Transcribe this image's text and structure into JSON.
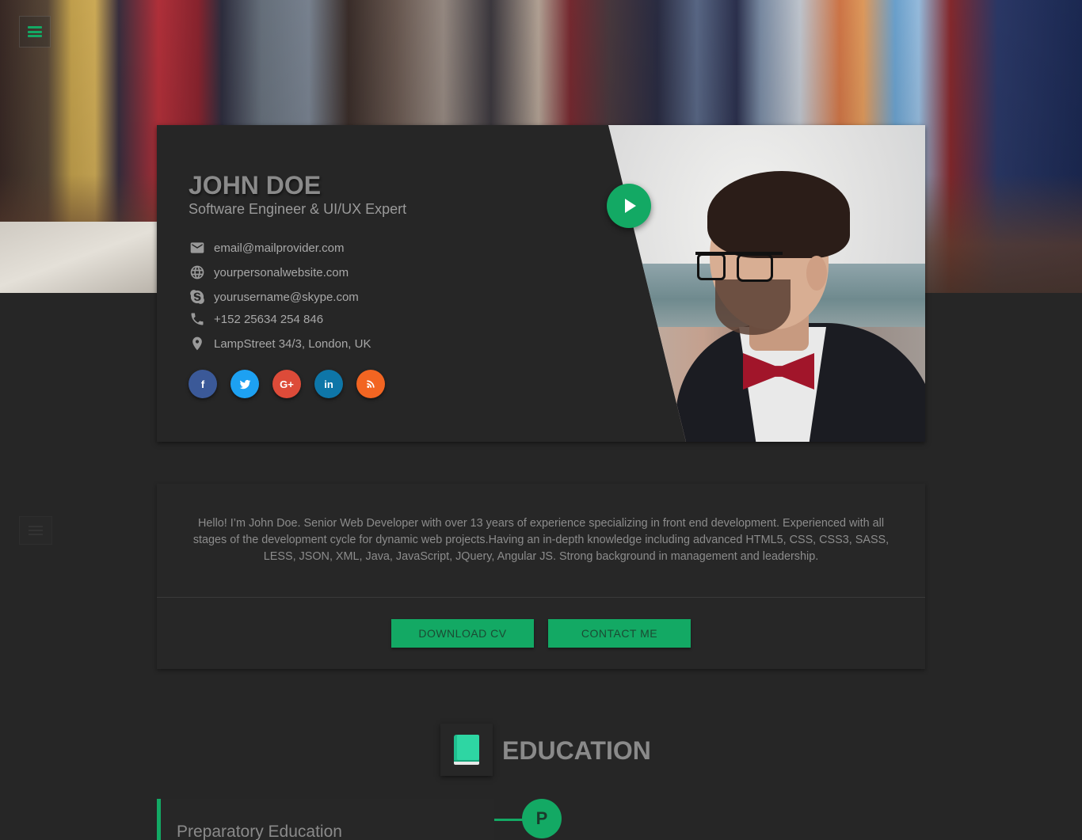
{
  "accent_color": "#13a964",
  "nav": {
    "menu_icon": "hamburger-icon"
  },
  "profile": {
    "name": "JOHN DOE",
    "role": "Software Engineer & UI/UX Expert",
    "contacts": [
      {
        "icon": "mail-icon",
        "text": "email@mailprovider.com"
      },
      {
        "icon": "globe-icon",
        "text": "yourpersonalwebsite.com"
      },
      {
        "icon": "skype-icon",
        "text": "yourusername@skype.com"
      },
      {
        "icon": "phone-icon",
        "text": "+152 25634 254 846"
      },
      {
        "icon": "location-icon",
        "text": "LampStreet 34/3, London, UK"
      }
    ],
    "socials": [
      {
        "name": "facebook",
        "glyph": "f",
        "color": "#3b5998"
      },
      {
        "name": "twitter",
        "glyph": "t",
        "color": "#1da1f2"
      },
      {
        "name": "google-plus",
        "glyph": "G+",
        "color": "#dd4b39"
      },
      {
        "name": "linkedin",
        "glyph": "in",
        "color": "#0e76a8"
      },
      {
        "name": "rss",
        "glyph": "rss",
        "color": "#f26522"
      }
    ],
    "play_icon": "play-icon"
  },
  "about": {
    "text": "Hello! I’m John Doe. Senior Web Developer with over 13 years of experience specializing in front end development. Experienced with all stages of the development cycle for dynamic web projects.Having an in-depth knowledge including advanced HTML5, CSS, CSS3, SASS, LESS, JSON, XML, Java, JavaScript, JQuery, Angular JS. Strong background in management and leadership.",
    "download_label": "DOWNLOAD CV",
    "contact_label": "CONTACT ME"
  },
  "education": {
    "title": "EDUCATION",
    "icon": "book-icon",
    "items": [
      {
        "title": "Preparatory Education",
        "marker": "P"
      }
    ]
  }
}
